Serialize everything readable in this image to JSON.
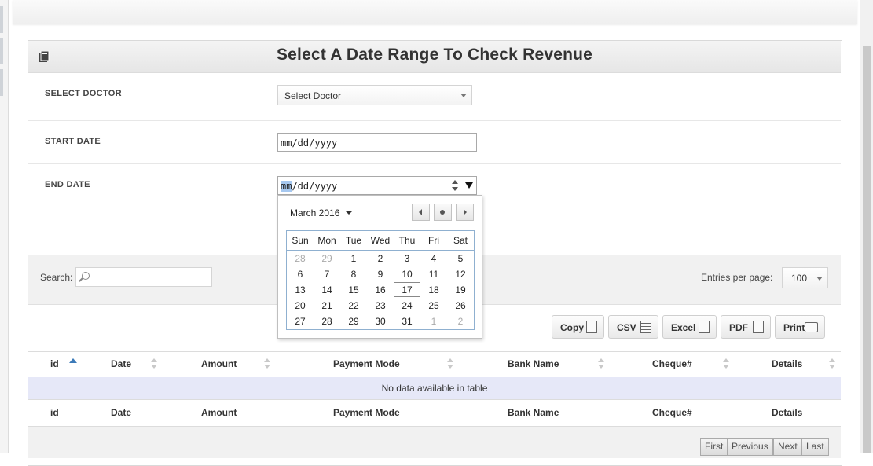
{
  "page": {
    "title": "Select A Date Range To Check Revenue"
  },
  "form": {
    "doctor_label": "SELECT DOCTOR",
    "doctor_value": "Select Doctor",
    "start_label": "START DATE",
    "start_value": "mm/dd/yyyy",
    "end_label": "END DATE",
    "end_value_mm": "mm",
    "end_value_rest": "/dd/yyyy"
  },
  "calendar": {
    "month_label": "March 2016",
    "weekdays": [
      "Sun",
      "Mon",
      "Tue",
      "Wed",
      "Thu",
      "Fri",
      "Sat"
    ],
    "weeks": [
      [
        "28",
        "29",
        "1",
        "2",
        "3",
        "4",
        "5"
      ],
      [
        "6",
        "7",
        "8",
        "9",
        "10",
        "11",
        "12"
      ],
      [
        "13",
        "14",
        "15",
        "16",
        "17",
        "18",
        "19"
      ],
      [
        "20",
        "21",
        "22",
        "23",
        "24",
        "25",
        "26"
      ],
      [
        "27",
        "28",
        "29",
        "30",
        "31",
        "1",
        "2"
      ]
    ],
    "today": "17"
  },
  "table_tools": {
    "search_label": "Search:",
    "entries_label": "Entries per page:",
    "entries_value": "100",
    "export": {
      "copy": "Copy",
      "csv": "CSV",
      "excel": "Excel",
      "pdf": "PDF",
      "print": "Print"
    }
  },
  "table": {
    "columns": [
      "id",
      "Date",
      "Amount",
      "Payment Mode",
      "Bank Name",
      "Cheque#",
      "Details"
    ],
    "empty_message": "No data available in table"
  },
  "pagination": {
    "first": "First",
    "previous": "Previous",
    "next": "Next",
    "last": "Last"
  },
  "colors": {
    "accent": "#3c7ab8",
    "empty_row": "#e6e8f8",
    "panel_header": "#e6e6e6"
  }
}
